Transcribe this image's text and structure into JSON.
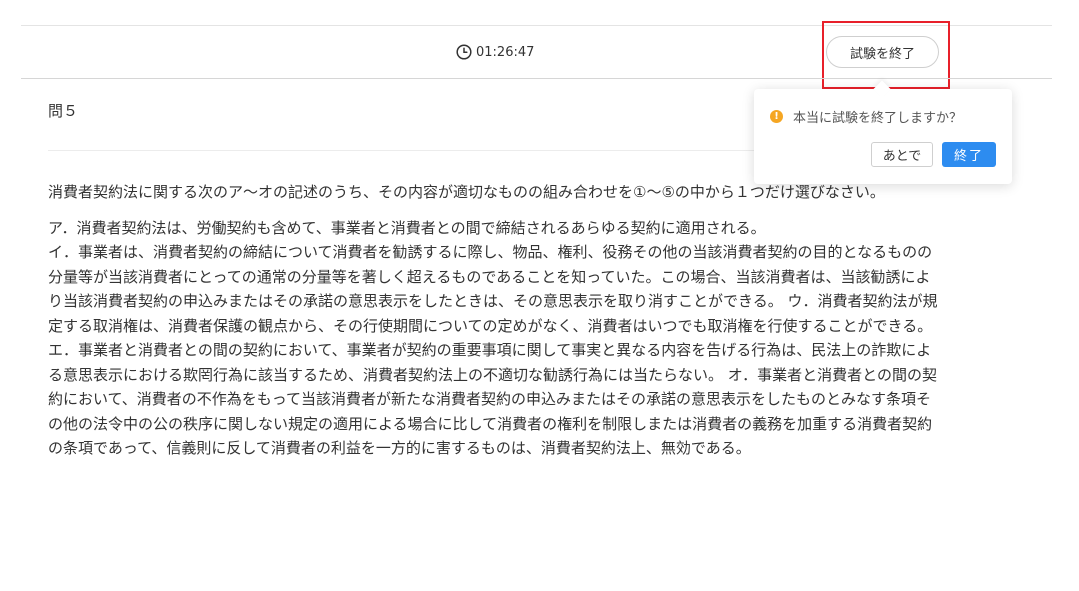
{
  "header": {
    "timer": "01:26:47",
    "end_exam_label": "試験を終了"
  },
  "question": {
    "number": "問５",
    "stem": "消費者契約法に関する次のア～オの記述のうち、その内容が適切なものの組み合わせを①～⑤の中から１つだけ選びなさい。",
    "lines": [
      "ア．消費者契約法は、労働契約も含めて、事業者と消費者との間で締結されるあらゆる契約に適用される。",
      "イ．事業者は、消費者契約の締結について消費者を勧誘するに際し、物品、権利、役務その他の当該消費者契約の目的となるものの分量等が当該消費者にとっての通常の分量等を著しく超えるものであることを知っていた。この場合、当該消費者は、当該勧誘により当該消費者契約の申込みまたはその承諾の意思表示をしたときは、その意思表示を取り消すことができる。 ウ．消費者契約法が規定する取消権は、消費者保護の観点から、その行使期間についての定めがなく、消費者はいつでも取消権を行使することができる。 エ．事業者と消費者との間の契約において、事業者が契約の重要事項に関して事実と異なる内容を告げる行為は、民法上の詐欺による意思表示における欺罔行為に該当するため、消費者契約法上の不適切な勧誘行為には当たらない。 オ．事業者と消費者との間の契約において、消費者の不作為をもって当該消費者が新たな消費者契約の申込みまたはその承諾の意思表示をしたものとみなす条項その他の法令中の公の秩序に関しない規定の適用による場合に比して消費者の権利を制限しまたは消費者の義務を加重する消費者契約の条項であって、信義則に反して消費者の利益を一方的に害するものは、消費者契約法上、無効である。"
    ]
  },
  "popover": {
    "message": "本当に試験を終了しますか？",
    "warn_icon": "!",
    "later_label": "あとで",
    "confirm_label": "終了"
  },
  "colors": {
    "highlight": "#e8202a",
    "primary": "#2d8cf0",
    "warning": "#f5a623"
  }
}
